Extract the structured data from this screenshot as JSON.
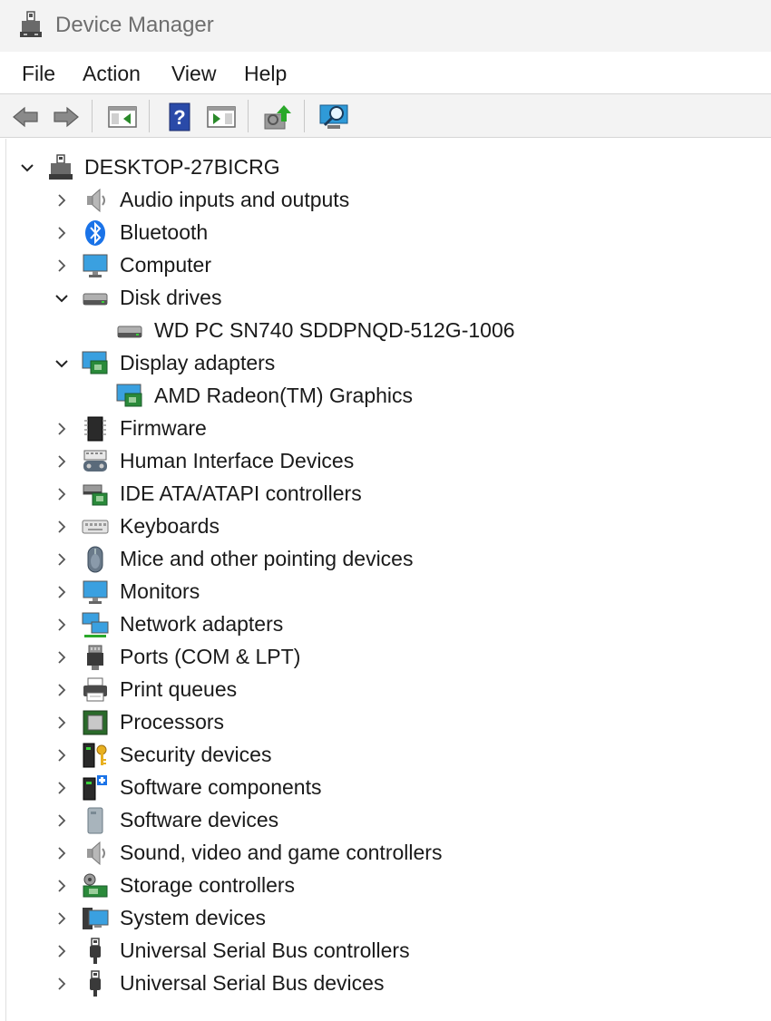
{
  "window": {
    "title": "Device Manager"
  },
  "menu": [
    "File",
    "Action",
    "View",
    "Help"
  ],
  "toolbar": {
    "buttons": [
      "back-arrow-icon",
      "forward-arrow-icon",
      "show-hide-console-tree-icon",
      "help-icon",
      "show-hide-action-pane-icon",
      "update-driver-icon",
      "scan-hardware-icon"
    ]
  },
  "tree": {
    "root": "DESKTOP-27BICRG",
    "items": [
      {
        "label": "Audio inputs and outputs",
        "icon": "speaker-icon",
        "expanded": false
      },
      {
        "label": "Bluetooth",
        "icon": "bluetooth-icon",
        "expanded": false
      },
      {
        "label": "Computer",
        "icon": "monitor-icon",
        "expanded": false
      },
      {
        "label": "Disk drives",
        "icon": "disk-drive-icon",
        "expanded": true,
        "children": [
          "WD PC SN740 SDDPNQD-512G-1006"
        ]
      },
      {
        "label": "Display adapters",
        "icon": "display-adapter-icon",
        "expanded": true,
        "children": [
          "AMD Radeon(TM) Graphics"
        ]
      },
      {
        "label": "Firmware",
        "icon": "chip-icon",
        "expanded": false
      },
      {
        "label": "Human Interface Devices",
        "icon": "hid-icon",
        "expanded": false
      },
      {
        "label": "IDE ATA/ATAPI controllers",
        "icon": "ide-controller-icon",
        "expanded": false
      },
      {
        "label": "Keyboards",
        "icon": "keyboard-icon",
        "expanded": false
      },
      {
        "label": "Mice and other pointing devices",
        "icon": "mouse-icon",
        "expanded": false
      },
      {
        "label": "Monitors",
        "icon": "monitor-icon",
        "expanded": false
      },
      {
        "label": "Network adapters",
        "icon": "network-icon",
        "expanded": false
      },
      {
        "label": "Ports (COM & LPT)",
        "icon": "port-icon",
        "expanded": false
      },
      {
        "label": "Print queues",
        "icon": "printer-icon",
        "expanded": false
      },
      {
        "label": "Processors",
        "icon": "processor-icon",
        "expanded": false
      },
      {
        "label": "Security devices",
        "icon": "security-icon",
        "expanded": false
      },
      {
        "label": "Software components",
        "icon": "software-component-icon",
        "expanded": false
      },
      {
        "label": "Software devices",
        "icon": "software-device-icon",
        "expanded": false
      },
      {
        "label": "Sound, video and game controllers",
        "icon": "speaker-icon",
        "expanded": false
      },
      {
        "label": "Storage controllers",
        "icon": "storage-controller-icon",
        "expanded": false
      },
      {
        "label": "System devices",
        "icon": "system-device-icon",
        "expanded": false
      },
      {
        "label": "Universal Serial Bus controllers",
        "icon": "usb-icon",
        "expanded": false
      },
      {
        "label": "Universal Serial Bus devices",
        "icon": "usb-icon",
        "expanded": false
      }
    ]
  }
}
